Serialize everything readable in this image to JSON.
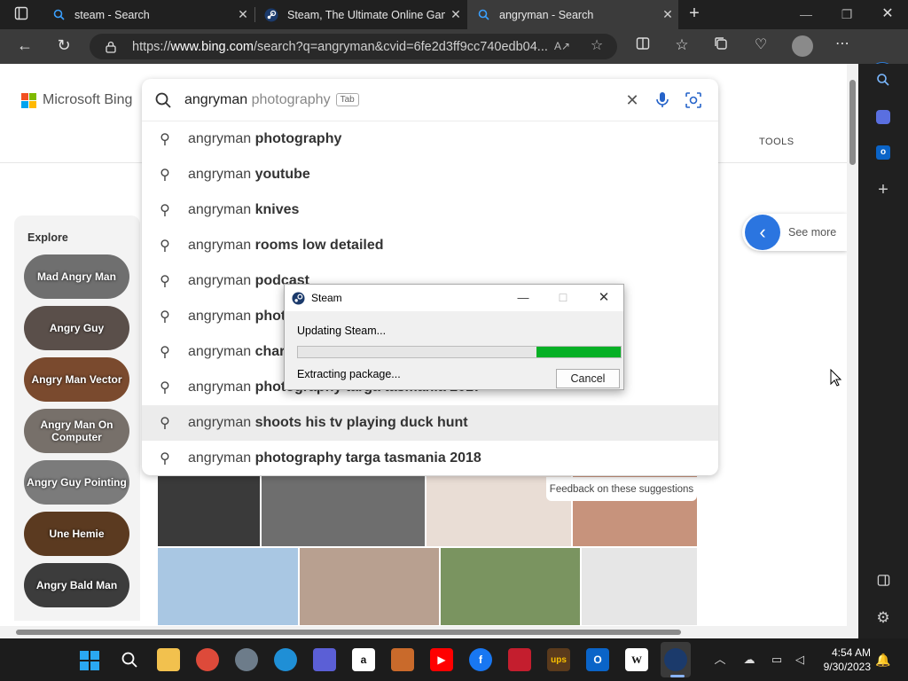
{
  "browser": {
    "tabs": [
      {
        "title": "steam - Search",
        "active": false
      },
      {
        "title": "Steam, The Ultimate Online Gam",
        "active": false
      },
      {
        "title": "angryman - Search",
        "active": true
      }
    ],
    "url_prefix": "https://",
    "url_host": "www.bing.com",
    "url_rest": "/search?q=angryman&cvid=6fe2d3ff9cc740edb04..."
  },
  "bing": {
    "logo": "Microsoft Bing",
    "search_typed": "angryman",
    "search_ghost": " photography",
    "tab_hint": "Tab",
    "tools_label": "TOOLS",
    "see_more": "See more",
    "explore_title": "Explore",
    "explore_items": [
      "Mad Angry Man",
      "Angry Guy",
      "Angry Man Vector",
      "Angry Man On Computer",
      "Angry Guy Pointing",
      "Une Hemie",
      "Angry Bald Man"
    ],
    "feedback": "Feedback on these suggestions",
    "suggestions": [
      {
        "prefix": "angryman ",
        "bold": "photography"
      },
      {
        "prefix": "angryman ",
        "bold": "youtube"
      },
      {
        "prefix": "angryman ",
        "bold": "knives"
      },
      {
        "prefix": "angryman ",
        "bold": "rooms low detailed"
      },
      {
        "prefix": "angryman ",
        "bold": "podcast"
      },
      {
        "prefix": "angryman ",
        "bold": "phot"
      },
      {
        "prefix": "angryman ",
        "bold": "char"
      },
      {
        "prefix": "angryman ",
        "bold": "photography targa tasmania 2017"
      },
      {
        "prefix": "angryman ",
        "bold": "shoots his tv playing duck hunt"
      },
      {
        "prefix": "angryman ",
        "bold": "photography targa tasmania 2018"
      }
    ]
  },
  "steam_dialog": {
    "title": "Steam",
    "status": "Updating Steam...",
    "progress": 0.26,
    "detail": "Extracting package...",
    "cancel": "Cancel"
  },
  "taskbar": {
    "time": "4:54 AM",
    "date": "9/30/2023"
  },
  "colors": {
    "accent": "#0067b8",
    "progress": "#06b025"
  }
}
